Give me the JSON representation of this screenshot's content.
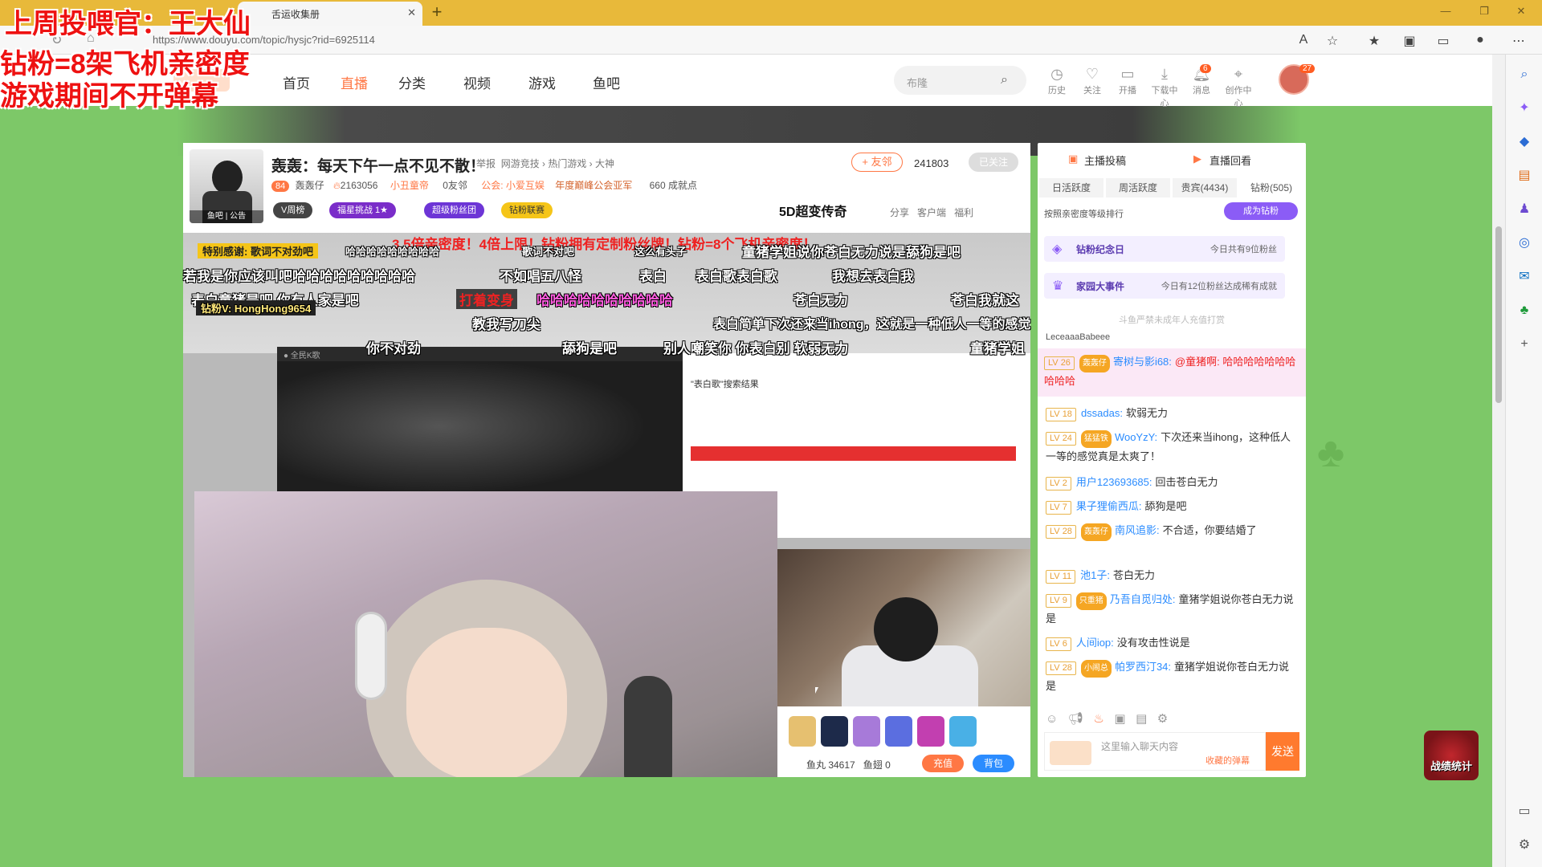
{
  "browser": {
    "tab_title": "舌运收集册",
    "url": "https://www.douyu.com/topic/hysjc?rid=6925114"
  },
  "overlay": {
    "line1": "上周投喂官：王大仙",
    "line2": "钻粉=8架飞机亲密度",
    "line3": "游戏期间不开弹幕"
  },
  "header": {
    "nav": [
      "首页",
      "直播",
      "分类",
      "视频",
      "游戏",
      "鱼吧"
    ],
    "search_placeholder": "布隆",
    "icons": [
      {
        "label": "历史",
        "icon": "clock-icon"
      },
      {
        "label": "关注",
        "icon": "heart-icon"
      },
      {
        "label": "开播",
        "icon": "camera-icon"
      },
      {
        "label": "下载中心",
        "icon": "download-icon"
      },
      {
        "label": "消息",
        "icon": "bell-icon",
        "badge": "6"
      },
      {
        "label": "创作中心",
        "icon": "pin-icon"
      }
    ],
    "avatar_badge": "27"
  },
  "room": {
    "title": "轰轰：每天下午一点不见不散！",
    "report": "举报",
    "category": "网游竞技 › 热门游戏 › 大神",
    "follow_label": "+ 友邻",
    "follow_count": "241803",
    "followed_label": "已关注",
    "level": "84",
    "streamer": "轰轰仔",
    "hot": "2163056",
    "tag1": "小丑童帝",
    "friends": "0友邻",
    "guild": "公会: 小爱互娱",
    "guild_award": "年度巅峰公会亚军",
    "achievement": "660 成就点",
    "thumb_caption": "鱼吧 | 公告",
    "pills": [
      "V周榜",
      "福星挑战 1★",
      "超级粉丝团",
      "钻粉联赛"
    ],
    "ad": "5D超变传奇",
    "actions": [
      "分享",
      "客户端",
      "福利"
    ]
  },
  "danmaku": [
    "3.5倍亲密度！4倍上限！钻粉拥有定制粉丝牌！钻粉=8个飞机亲密度！",
    "特别感谢: 歌词不对劲吧",
    "哈哈哈哈哈哈哈哈哈",
    "歌词不对吧",
    "这么有头子",
    "童猪学姐说你苍白无力说是舔狗是吧",
    "若我是你应该叫吧哈哈哈哈哈哈哈哈哈",
    "不如唱五八怪",
    "表白",
    "表白歌表白歌",
    "我想去表白我",
    "表白童猪是吧 你有人家是吧",
    "打着变身",
    "哈哈哈哈哈哈哈哈哈哈",
    "苍白无力",
    "苍白我就这",
    "钻粉V: HongHong9654",
    "教我写刀尖",
    "表白简单下次还来当ihong，这就是一种低人一等的感觉",
    "你不对劲",
    "舔狗是吧",
    "别人嘲笑你 你表白别 软弱无力",
    "童猪学姐"
  ],
  "video": {
    "search_title": "\"表白歌\"搜索结果",
    "gift_coin": "鱼丸 34617",
    "gift_fish": "鱼翅 0",
    "charge": "充值",
    "bag": "背包"
  },
  "chat": {
    "tabs_top": [
      "主播投稿",
      "直播回看"
    ],
    "tabs": [
      "日活跃度",
      "周活跃度",
      "贵宾(4434)",
      "钻粉(505)"
    ],
    "rank_label": "按照亲密度等级排行",
    "become": "成为钻粉",
    "card1_title": "钻粉纪念日",
    "card1_right": "今日共有9位粉丝",
    "card2_title": "家园大事件",
    "card2_right": "今日有12位粉丝达成稀有成就",
    "nominor": "斗鱼严禁未成年人充值打赏",
    "first_user": "LeceaaaBabeee",
    "highlight": {
      "lv": "LV 26",
      "fan": "轰轰仔",
      "name": "寄树与影i68:",
      "text": "@童猪啊: 哈哈哈哈哈哈哈哈哈哈"
    },
    "messages": [
      {
        "lv": "LV 18",
        "fan": "",
        "name": "dssadas:",
        "text": "软弱无力"
      },
      {
        "lv": "LV 24",
        "fan": "猛猛铁",
        "name": "WooYzY:",
        "text": "下次还来当ihong，这种低人一等的感觉真是太爽了！"
      },
      {
        "lv": "LV 2",
        "fan": "",
        "name": "用户123693685:",
        "text": "回击苍白无力"
      },
      {
        "lv": "LV 7",
        "fan": "",
        "name": "果子狸偷西瓜:",
        "text": "舔狗是吧"
      },
      {
        "lv": "LV 28",
        "fan": "轰轰仔",
        "name": "南风追影:",
        "text": "不合适，你要结婚了"
      },
      {
        "lv": "LV 11",
        "fan": "",
        "name": "池1子:",
        "text": "苍白无力"
      },
      {
        "lv": "LV 9",
        "fan": "只重猪",
        "name": "乃吾自觅归处:",
        "text": "童猪学姐说你苍白无力说是"
      },
      {
        "lv": "LV 6",
        "fan": "",
        "name": "人间iop:",
        "text": "没有攻击性说是"
      },
      {
        "lv": "LV 28",
        "fan": "小闹总",
        "name": "帕罗西汀34:",
        "text": "童猪学姐说你苍白无力说是"
      }
    ],
    "input_placeholder": "这里输入聊天内容",
    "fav_danmaku": "收藏的弹幕",
    "send": "发送"
  },
  "battle": "战绩统计"
}
